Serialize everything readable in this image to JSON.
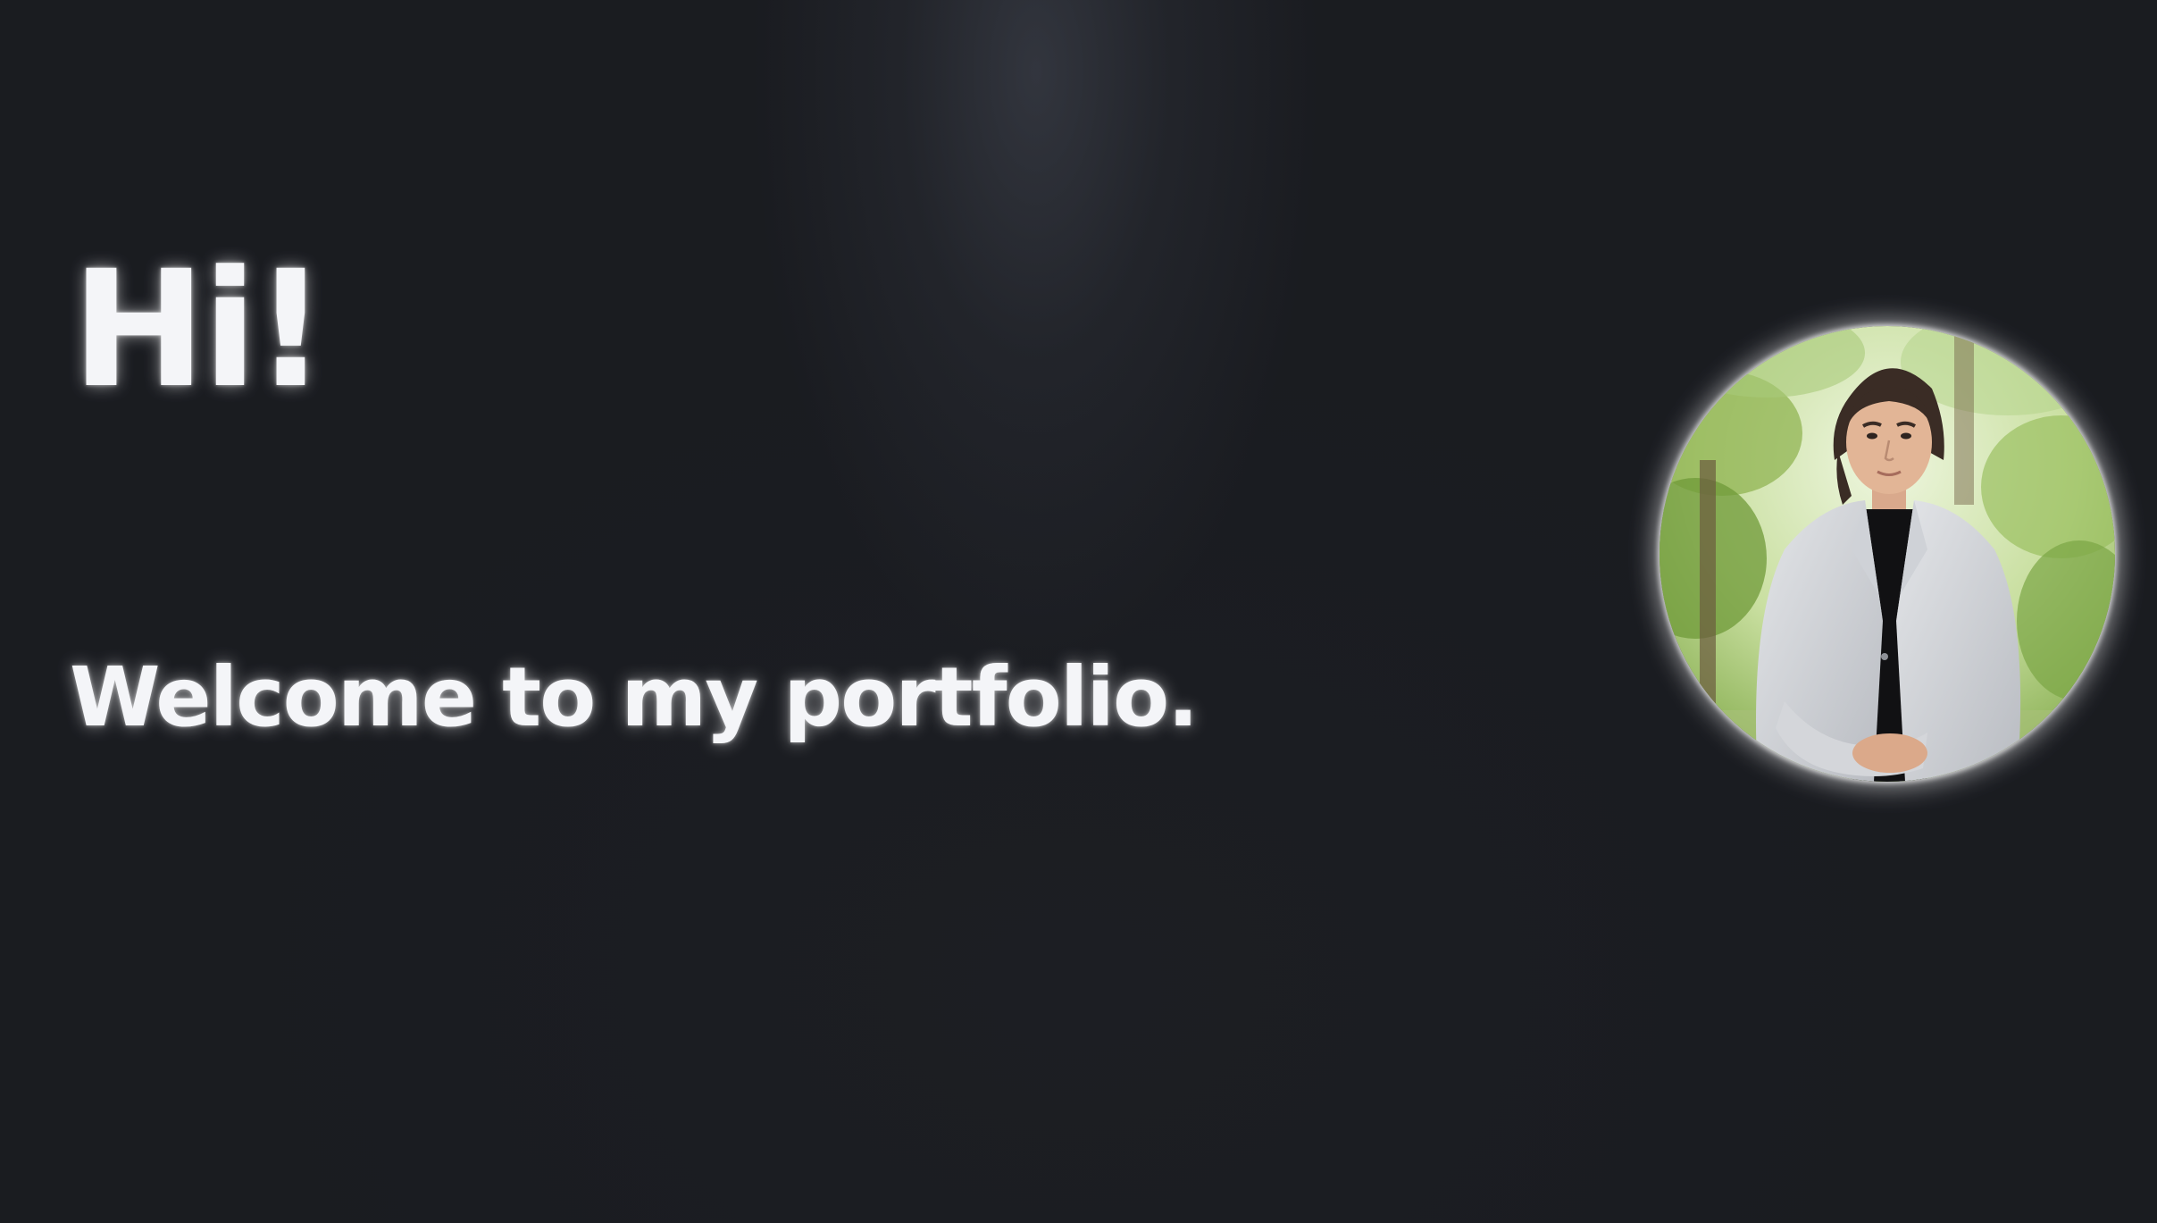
{
  "hero": {
    "greeting": "Hi!",
    "subtitle": "Welcome to my portfolio."
  },
  "colors": {
    "background": "#1c1e23",
    "text": "#f4f5f8"
  },
  "avatar": {
    "icon": "profile-photo"
  }
}
